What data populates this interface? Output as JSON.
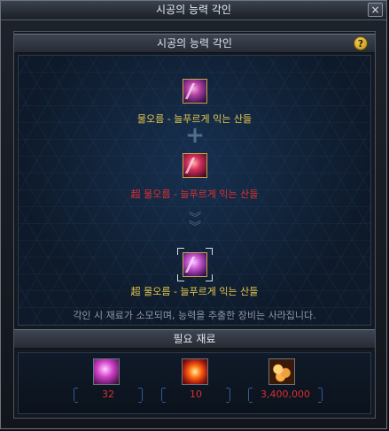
{
  "window": {
    "title": "시공의 능력 각인",
    "close_icon": "×"
  },
  "header": {
    "title": "시공의 능력 각인",
    "help_label": "?"
  },
  "engrave": {
    "source_item_name": "물오름 - 늘푸르게 익는 산들",
    "plus_symbol": "+",
    "catalyst_item_name": "超 물오름 - 늘푸르게 익는 산들",
    "result_item_name": "超 물오름 - 늘푸르게 익는 산들",
    "note": "각인 시 재료가 소모되며, 능력을 추출한 장비는 사라집니다."
  },
  "materials": {
    "title": "필요 재료",
    "items": [
      {
        "icon": "orb-icon",
        "count": "32"
      },
      {
        "icon": "burst-icon",
        "count": "10"
      },
      {
        "icon": "gold-coins-icon",
        "count": "3,400,000"
      }
    ]
  },
  "colors": {
    "gold_text": "#e6c84a",
    "red_text": "#e03030",
    "count_text": "#d83030"
  }
}
